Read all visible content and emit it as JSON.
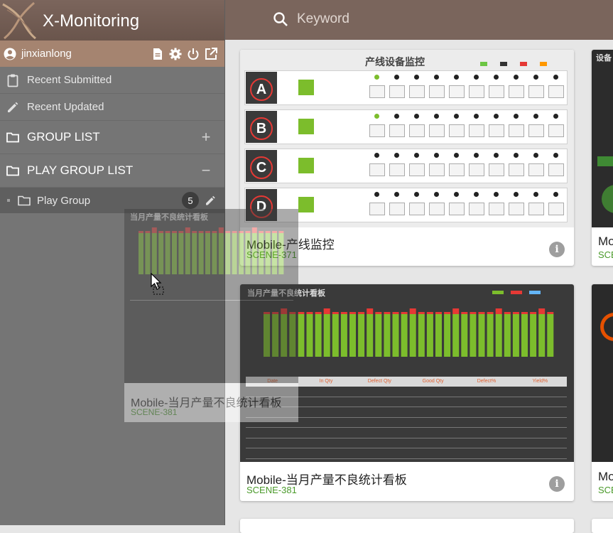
{
  "app": {
    "title": "X-Monitoring"
  },
  "user": {
    "name": "jinxianlong"
  },
  "user_actions": [
    "document-icon",
    "gear-icon",
    "power-icon",
    "open-external-icon"
  ],
  "nav": {
    "recent_submitted": "Recent Submitted",
    "recent_updated": "Recent Updated",
    "group_list": "GROUP LIST",
    "group_list_action": "+",
    "play_group_list": "PLAY GROUP LIST",
    "play_group_list_action": "−",
    "play_group": {
      "label": "Play Group",
      "count": "5"
    }
  },
  "search": {
    "placeholder": "Keyword"
  },
  "cards": [
    {
      "title": "Mobile-产线监控",
      "code": "SCENE-371",
      "thumb": {
        "heading": "产线设备监控",
        "lines": [
          "A",
          "B",
          "C",
          "D"
        ],
        "legend_colors": [
          "#6cc644",
          "#333333",
          "#e53935",
          "#ff9800"
        ]
      }
    },
    {
      "title": "Mobile-当月产量不良统计看板",
      "code": "SCENE-381",
      "thumb": {
        "heading": "当月产量不良统计看板",
        "columns": [
          "Date",
          "In Qty",
          "Defect Qty",
          "Good Qty",
          "Defect%",
          "Yield%"
        ]
      }
    },
    {
      "title": "Mo",
      "code": "SCE",
      "thumb": {
        "heading": "设备"
      }
    },
    {
      "title": "Mo",
      "code": "SCE"
    }
  ],
  "ghost": {
    "title": "Mobile-当月产量不良统计看板",
    "code": "SCENE-381"
  },
  "colors": {
    "header": "#7a655c",
    "userbar": "#a58470",
    "sidebar": "#757575",
    "accent_green": "#4a9a2a",
    "bar_green": "#7cbd2c",
    "bar_red": "#e53935"
  }
}
